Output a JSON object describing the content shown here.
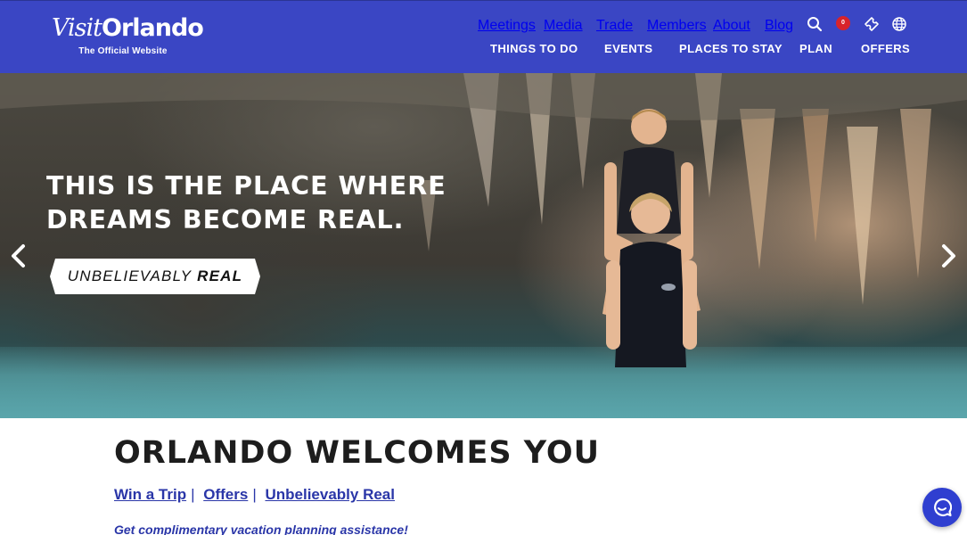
{
  "brand": {
    "logo_visit": "Visit",
    "logo_orlando": "Orlando",
    "tagline": "The Official Website",
    "primary_color": "#3a46c4",
    "link_color": "#2a36a8",
    "alert_color": "#d8232a"
  },
  "utility_nav": {
    "meetings": "Meetings",
    "media": "Media",
    "trade": "Trade",
    "members": "Members",
    "about": "About",
    "blog": "Blog",
    "favorites_count": "0",
    "icons": [
      "search-icon",
      "heart-icon",
      "ticket-icon",
      "globe-icon"
    ]
  },
  "main_nav": {
    "things_to_do": "THINGS TO DO",
    "events": "EVENTS",
    "places_to_stay": "PLACES TO STAY",
    "plan": "PLAN",
    "offers": "OFFERS"
  },
  "hero": {
    "headline_line1": "THIS IS THE PLACE WHERE",
    "headline_line2": "DREAMS BECOME REAL.",
    "tagline_word1": "UNBELIEVABLY",
    "tagline_word2": "REAL"
  },
  "content": {
    "title": "ORLANDO WELCOMES YOU",
    "links": {
      "win_trip": "Win a Trip",
      "separator": "|",
      "offers": "Offers",
      "unbelievably_real": "Unbelievably Real"
    },
    "planning_text": "Get complimentary vacation planning assistance!"
  }
}
